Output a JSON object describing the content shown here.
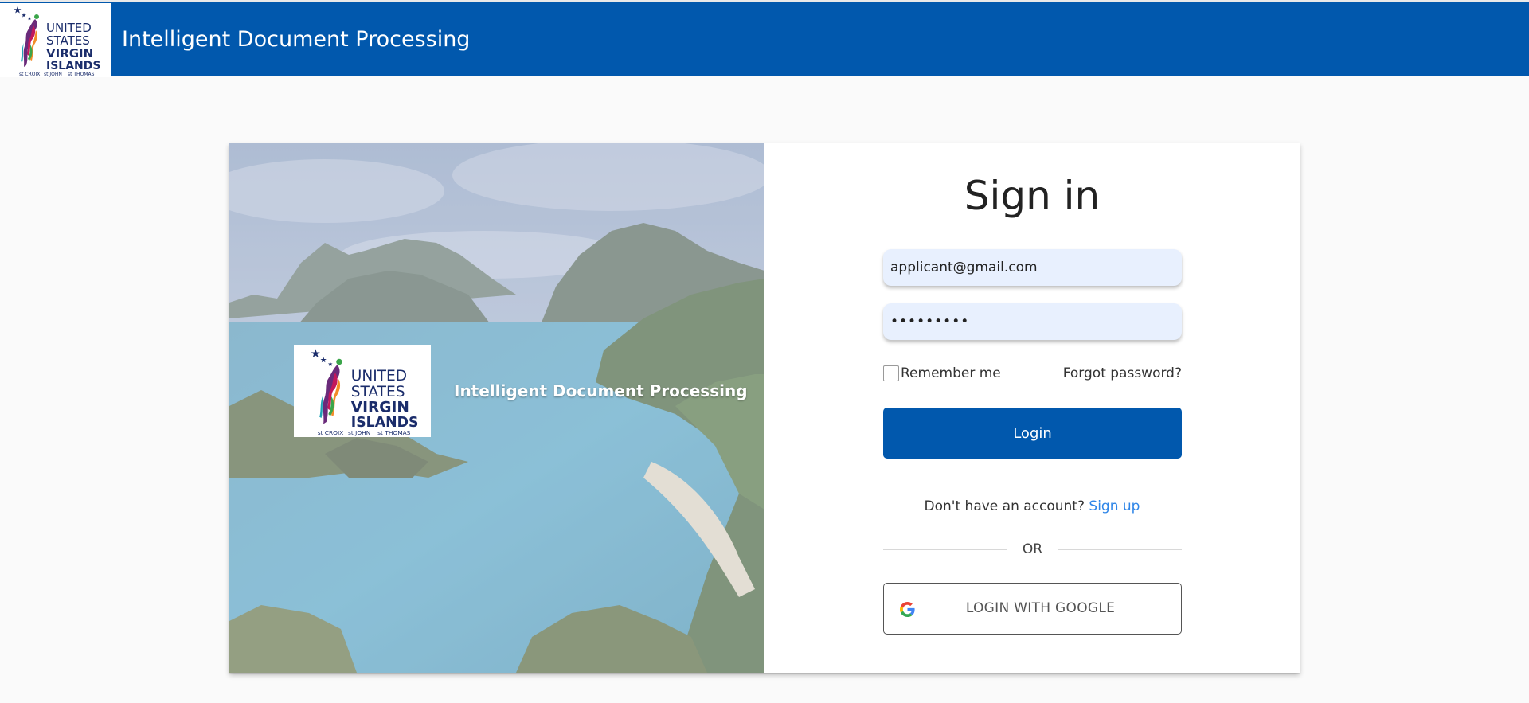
{
  "header": {
    "logo_alt": "United States Virgin Islands logo",
    "app_title": "Intelligent Document Processing"
  },
  "logo": {
    "line1": "UNITED",
    "line2": "STATES",
    "line3": "VIRGIN",
    "line4": "ISLANDS",
    "islands": [
      "st CROIX",
      "st JOHN",
      "st THOMAS"
    ],
    "colors": {
      "blue": "#1b2d6b",
      "purple": "#6a2a7a",
      "magenta": "#c2185b",
      "orange": "#f28c28",
      "green": "#3aa54a",
      "teal": "#1fa3b5"
    }
  },
  "hero": {
    "title": "Intelligent Document Processing"
  },
  "signin": {
    "title": "Sign in",
    "email_value": "applicant@gmail.com",
    "password_value": "•••••••••",
    "remember_label": "Remember me",
    "remember_checked": false,
    "forgot_label": "Forgot password?",
    "login_label": "Login",
    "signup_prompt": "Don't have an account?",
    "signup_link": "Sign up",
    "or_label": "OR",
    "google_label": "LOGIN WITH GOOGLE"
  },
  "colors": {
    "header_bg": "#0158ad",
    "primary": "#0158ad",
    "link": "#2f86e8",
    "input_bg": "#e8f0fe",
    "page_bg": "#fafafa"
  },
  "icons": {
    "google": "google-g-icon",
    "star": "star-icon"
  }
}
